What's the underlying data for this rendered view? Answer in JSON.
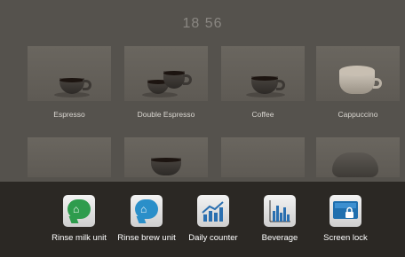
{
  "clock": {
    "time": "18 56"
  },
  "beverages": [
    {
      "label": "Espresso"
    },
    {
      "label": "Double Espresso"
    },
    {
      "label": "Coffee"
    },
    {
      "label": "Cappuccino"
    }
  ],
  "actions": [
    {
      "label": "Rinse milk unit",
      "icon": "rinse-milk-icon",
      "color": "#2e9c4d"
    },
    {
      "label": "Rinse brew unit",
      "icon": "rinse-brew-icon",
      "color": "#2a8fc9"
    },
    {
      "label": "Daily counter",
      "icon": "daily-counter-icon",
      "color": "#2a6fb0"
    },
    {
      "label": "Beverage",
      "icon": "beverage-chart-icon",
      "color": "#2a6fb0"
    },
    {
      "label": "Screen lock",
      "icon": "screen-lock-icon",
      "color": "#1f6fae"
    }
  ]
}
